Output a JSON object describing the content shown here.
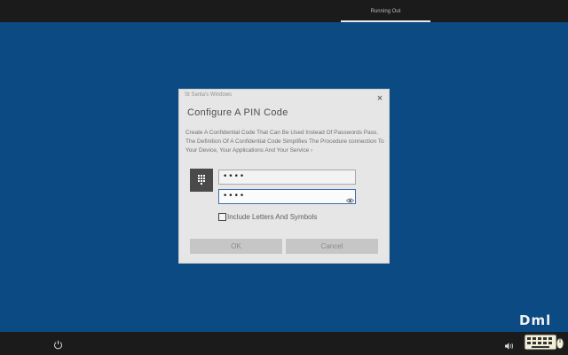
{
  "topbar": {
    "tab_label": "Running Out"
  },
  "watermark": {
    "text": "Dml"
  },
  "dialog": {
    "caption": "St Santa's Windows",
    "close_glyph": "×",
    "title": "Configure A PIN Code",
    "description": "Create A Confidential Code That Can Be Used Instead Of Passwords Pass. The Definition Of A Confidential Code Simplifies The Procedure connection To Your Device, Your Applications And Your Service ›",
    "pin_value": "••••",
    "confirm_value": "••••",
    "checkbox_label": "Include Letters And Symbols",
    "ok_label": "OK",
    "cancel_label": "Cancel"
  },
  "colors": {
    "background": "#0b4a82",
    "taskbar": "#1b1b1b",
    "dialog": "#e6e6e6",
    "focus_border": "#3b6fae"
  },
  "icons": {
    "keypad": "keypad-icon",
    "power": "power-icon",
    "volume": "volume-icon",
    "reveal": "eye-icon",
    "close": "close-icon"
  }
}
